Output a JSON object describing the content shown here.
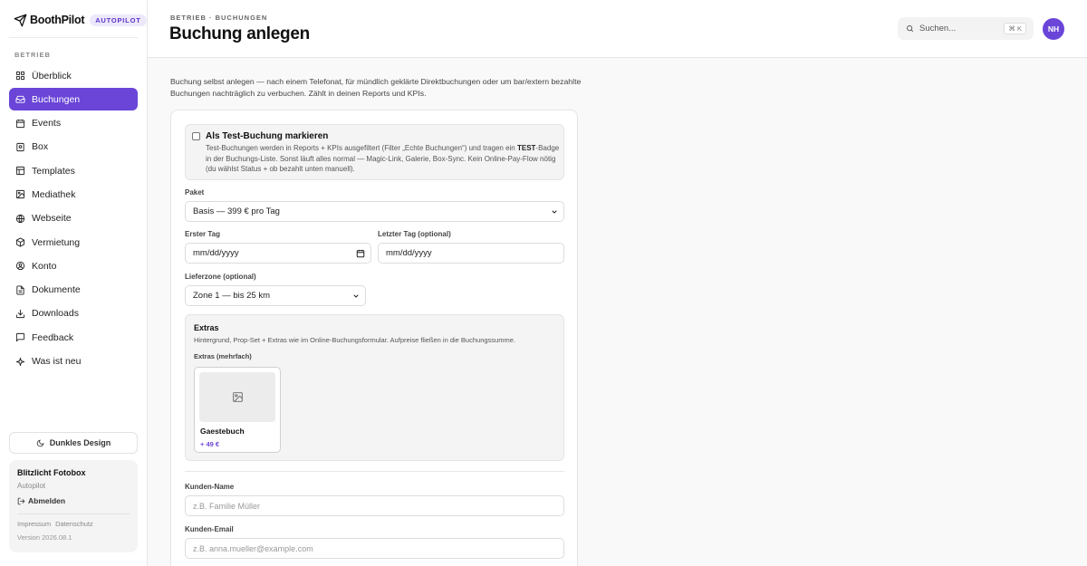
{
  "brand": {
    "name": "BoothPilot",
    "badge": "AUTOPILOT"
  },
  "sidebar": {
    "section": "BETRIEB",
    "items": [
      {
        "label": "Überblick",
        "icon": "grid-icon"
      },
      {
        "label": "Buchungen",
        "icon": "inbox-icon",
        "active": true
      },
      {
        "label": "Events",
        "icon": "calendar-icon"
      },
      {
        "label": "Box",
        "icon": "box-icon"
      },
      {
        "label": "Templates",
        "icon": "layers-icon"
      },
      {
        "label": "Mediathek",
        "icon": "image-icon"
      },
      {
        "label": "Webseite",
        "icon": "globe-icon"
      },
      {
        "label": "Vermietung",
        "icon": "package-icon"
      },
      {
        "label": "Konto",
        "icon": "user-circle-icon"
      },
      {
        "label": "Dokumente",
        "icon": "document-icon"
      },
      {
        "label": "Downloads",
        "icon": "download-icon"
      },
      {
        "label": "Feedback",
        "icon": "chat-icon"
      },
      {
        "label": "Was ist neu",
        "icon": "sparkle-icon"
      }
    ],
    "dark_mode_label": "Dunkles Design",
    "account": {
      "name": "Blitzlicht Fotobox",
      "plan": "Autopilot",
      "logout": "Abmelden",
      "impressum": "Impressum",
      "datenschutz": "Datenschutz",
      "version": "Version 2026.08.1"
    }
  },
  "header": {
    "breadcrumb": "BETRIEB · BUCHUNGEN",
    "title": "Buchung anlegen",
    "search_placeholder": "Suchen...",
    "search_shortcut": "⌘ K",
    "avatar_initials": "NH"
  },
  "intro": "Buchung selbst anlegen — nach einem Telefonat, für mündlich geklärte Direktbuchungen oder um bar/extern bezahlte Buchungen nachträglich zu verbuchen. Zählt in deinen Reports und KPIs.",
  "form": {
    "test": {
      "title": "Als Test-Buchung markieren",
      "desc_before": "Test-Buchungen werden in Reports + KPIs ausgefiltert (Filter „Echte Buchungen“) und tragen ein ",
      "desc_bold": "TEST",
      "desc_after": "-Badge in der Buchungs-Liste. Sonst läuft alles normal — Magic-Link, Galerie, Box-Sync. Kein Online-Pay-Flow nötig (du wählst Status + ob bezahlt unten manuell).",
      "checked": false
    },
    "paket_label": "Paket",
    "paket_value": "Basis — 399 € pro Tag",
    "first_day_label": "Erster Tag",
    "first_day_value": "mm/dd/yyyy",
    "last_day_label": "Letzter Tag (optional)",
    "last_day_value": "mm/dd/yyyy",
    "zone_label": "Lieferzone (optional)",
    "zone_value": "Zone 1 — bis 25 km",
    "extras": {
      "title": "Extras",
      "desc": "Hintergrund, Prop-Set + Extras wie im Online-Buchungsformular. Aufpreise fließen in die Buchungssumme.",
      "sub": "Extras (mehrfach)",
      "items": [
        {
          "name": "Gaestebuch",
          "price": "+ 49 €"
        }
      ]
    },
    "customer_name_label": "Kunden-Name",
    "customer_name_placeholder": "z.B. Familie Müller",
    "customer_email_label": "Kunden-Email",
    "customer_email_placeholder": "z.B. anna.mueller@example.com"
  },
  "colors": {
    "accent": "#6a45d8",
    "accent_soft": "#ede8fb"
  }
}
